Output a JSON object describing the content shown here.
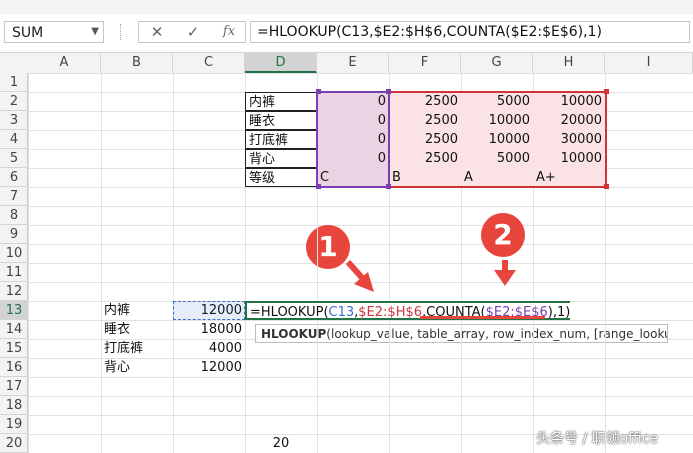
{
  "name_box": {
    "value": "SUM"
  },
  "formula_bar": {
    "cancel_icon": "close-icon",
    "enter_icon": "check-icon",
    "fx_label": "fx",
    "formula": "=HLOOKUP(C13,$E2:$H$6,COUNTA($E2:$E$6),1)"
  },
  "columns": [
    "A",
    "B",
    "C",
    "D",
    "E",
    "F",
    "G",
    "H",
    "I"
  ],
  "active_column": "D",
  "rows": [
    "1",
    "2",
    "3",
    "4",
    "5",
    "6",
    "7",
    "8",
    "9",
    "10",
    "11",
    "12",
    "13",
    "14",
    "15",
    "16",
    "17",
    "18",
    "19",
    "20"
  ],
  "active_row": "13",
  "lookup_table": {
    "labels": [
      "内裤",
      "睡衣",
      "打底裤",
      "背心",
      "等级"
    ],
    "E": [
      "0",
      "0",
      "0",
      "0",
      "C"
    ],
    "F": [
      "2500",
      "2500",
      "2500",
      "2500",
      "B"
    ],
    "G": [
      "5000",
      "10000",
      "10000",
      "5000",
      "A"
    ],
    "H": [
      "10000",
      "20000",
      "30000",
      "10000",
      "A+"
    ]
  },
  "input_rows": {
    "B": [
      "内裤",
      "睡衣",
      "打底裤",
      "背心"
    ],
    "C": [
      "12000",
      "18000",
      "4000",
      "12000"
    ]
  },
  "edit_cell": {
    "eq": "=HLOOKUP(",
    "ref1": "C13",
    "comma1": ",",
    "ref2": "$E2:$H$6",
    "mid": ",COUNTA(",
    "ref3": "$E2:$E$6",
    "tail": "),1)"
  },
  "tooltip": {
    "func": "HLOOKUP",
    "args": "(lookup_value, table_array, row_index_num, [range_lookup])"
  },
  "d20_value": "20",
  "callouts": [
    "1",
    "2"
  ],
  "watermark": "头条号 / 职领office",
  "colors": {
    "accent_green": "#217346",
    "callout_red": "#e8453c",
    "ref_blue": "#3b6fc9",
    "ref_red": "#d13438",
    "ref_purple": "#7a3fb0"
  }
}
